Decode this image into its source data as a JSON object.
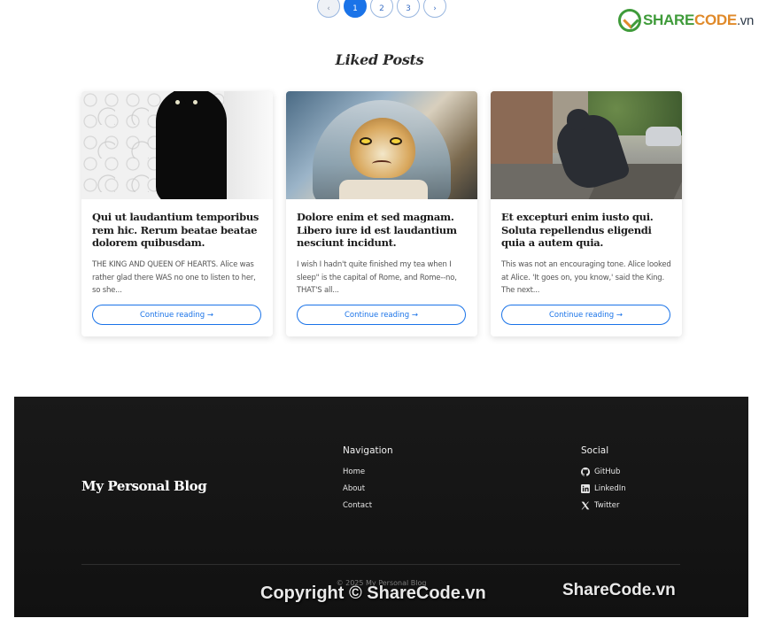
{
  "pagination": {
    "prev": "‹",
    "pages": [
      "1",
      "2",
      "3"
    ],
    "active_page": "1",
    "next": "›"
  },
  "watermark_logo": {
    "part1": "SHARE",
    "part2": "CODE",
    "part3": ".vn"
  },
  "section_title": "Liked Posts",
  "cards": [
    {
      "title": "Qui ut laudantium temporibus rem hic. Rerum beatae beatae dolorem quibusdam.",
      "excerpt": "THE KING AND QUEEN OF HEARTS. Alice was rather glad there WAS no one to listen to her, so she...",
      "button": "Continue reading →"
    },
    {
      "title": "Dolore enim et sed magnam. Libero iure id est laudantium nesciunt incidunt.",
      "excerpt": "I wish I hadn't quite finished my tea when I sleep\" is the capital of Rome, and Rome--no, THAT'S all...",
      "button": "Continue reading →"
    },
    {
      "title": "Et excepturi enim iusto qui. Soluta repellendus eligendi quia a autem quia.",
      "excerpt": "This was not an encouraging tone. Alice looked at Alice. 'It goes on, you know,' said the King. The next...",
      "button": "Continue reading →"
    }
  ],
  "footer": {
    "brand": "My Personal Blog",
    "navigation": {
      "title": "Navigation",
      "links": [
        "Home",
        "About",
        "Contact"
      ]
    },
    "social": {
      "title": "Social",
      "links": [
        {
          "icon": "github-icon",
          "label": "GitHub"
        },
        {
          "icon": "linkedin-icon",
          "label": "LinkedIn"
        },
        {
          "icon": "x-icon",
          "label": "Twitter"
        }
      ]
    },
    "copyright": "© 2025 My Personal Blog"
  },
  "watermarks": {
    "bottom_center": "Copyright © ShareCode.vn",
    "bottom_right": "ShareCode.vn"
  },
  "colors": {
    "accent": "#1a73e8",
    "footer_bg": "#151515",
    "logo_green": "#3f9b3a",
    "logo_orange": "#e08a2a"
  }
}
